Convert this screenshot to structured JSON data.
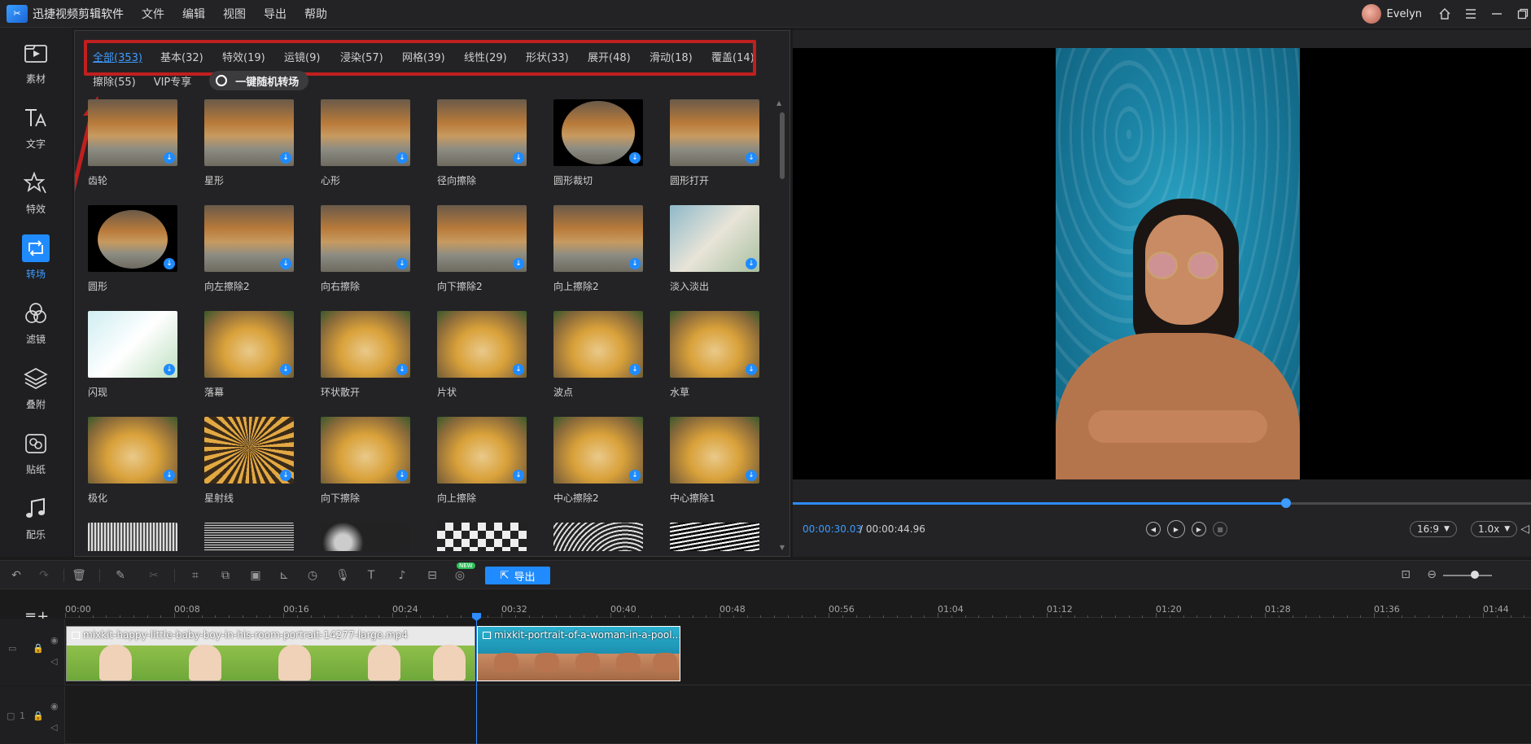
{
  "app": {
    "logo_text": "✂",
    "title": "迅捷视频剪辑软件",
    "menu": [
      "文件",
      "编辑",
      "视图",
      "导出",
      "帮助"
    ],
    "user": "Evelyn"
  },
  "leftnav": {
    "items": [
      {
        "label": "素材",
        "icon": "media-icon"
      },
      {
        "label": "文字",
        "icon": "text-icon"
      },
      {
        "label": "特效",
        "icon": "effects-icon"
      },
      {
        "label": "转场",
        "icon": "transition-icon",
        "active": true
      },
      {
        "label": "滤镜",
        "icon": "filter-icon"
      },
      {
        "label": "叠附",
        "icon": "overlay-icon"
      },
      {
        "label": "贴纸",
        "icon": "sticker-icon"
      },
      {
        "label": "配乐",
        "icon": "music-icon"
      }
    ]
  },
  "transitions": {
    "categories": [
      "全部(353)",
      "基本(32)",
      "特效(19)",
      "运镜(9)",
      "浸染(57)",
      "网格(39)",
      "线性(29)",
      "形状(33)",
      "展开(48)",
      "滑动(18)",
      "覆盖(14)"
    ],
    "categories_row2": [
      "擦除(55)",
      "VIP专享"
    ],
    "one_click_label": "一键随机转场",
    "items": [
      {
        "label": "齿轮"
      },
      {
        "label": "星形"
      },
      {
        "label": "心形"
      },
      {
        "label": "径向擦除"
      },
      {
        "label": "圆形裁切"
      },
      {
        "label": "圆形打开"
      },
      {
        "label": "圆形"
      },
      {
        "label": "向左擦除2"
      },
      {
        "label": "向右擦除"
      },
      {
        "label": "向下擦除2"
      },
      {
        "label": "向上擦除2"
      },
      {
        "label": "淡入淡出"
      },
      {
        "label": "闪现"
      },
      {
        "label": "落幕"
      },
      {
        "label": "环状散开"
      },
      {
        "label": "片状"
      },
      {
        "label": "波点"
      },
      {
        "label": "水草"
      },
      {
        "label": "极化"
      },
      {
        "label": "星射线"
      },
      {
        "label": "向下擦除"
      },
      {
        "label": "向上擦除"
      },
      {
        "label": "中心擦除2"
      },
      {
        "label": "中心擦除1"
      },
      {
        "label": ""
      },
      {
        "label": ""
      },
      {
        "label": ""
      },
      {
        "label": ""
      },
      {
        "label": ""
      },
      {
        "label": ""
      }
    ],
    "download_glyph": "↓"
  },
  "preview": {
    "current_time": "00:00:30.03",
    "total_time": "/ 00:00:44.96",
    "progress": 0.668,
    "aspect": "16:9",
    "speed": "1.0x"
  },
  "toolbar": {
    "export_label": "导出",
    "new_badge": "NEW"
  },
  "timeline": {
    "ticks": [
      "00:00",
      "00:08",
      "00:16",
      "00:24",
      "00:32",
      "00:40",
      "00:48",
      "00:56",
      "01:04",
      "01:12",
      "01:20",
      "01:28",
      "01:36",
      "01:44"
    ],
    "clips": [
      {
        "name": "mixkit-happy-little-baby-boy-in-his-room-portrait-14277-large.mp4"
      },
      {
        "name": "mixkit-portrait-of-a-woman-in-a-pool..."
      }
    ],
    "track2_label": "1"
  },
  "colors": {
    "accent": "#1f8bff",
    "highlight_box": "#c01f1f",
    "background": "#1b1b1c"
  }
}
